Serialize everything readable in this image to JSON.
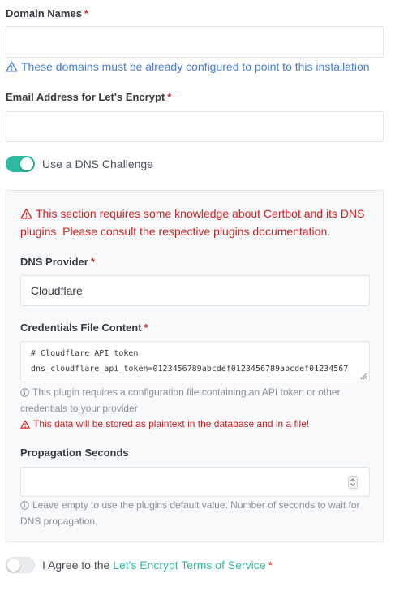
{
  "domain_names": {
    "label": "Domain Names",
    "required_mark": "*",
    "value": "",
    "hint": "These domains must be already configured to point to this installation"
  },
  "email": {
    "label": "Email Address for Let's Encrypt",
    "required_mark": "*",
    "value": ""
  },
  "dns_challenge": {
    "toggle_on": true,
    "label": "Use a DNS Challenge"
  },
  "dns_section": {
    "warning_line1": "This section requires some knowledge about Certbot and its DNS",
    "warning_line2": "plugins. Please consult the respective plugins documentation.",
    "provider_label": "DNS Provider",
    "provider_value": "Cloudflare",
    "credentials_label": "Credentials File Content",
    "credentials_line1": "# Cloudflare API token",
    "credentials_line2": "dns_cloudflare_api_token=0123456789abcdef0123456789abcdef01234567",
    "credentials_info_line1": "This plugin requires a configuration file containing an API token or other",
    "credentials_info_line2": "credentials to your provider",
    "credentials_warning": "This data will be stored as plaintext in the database and in a file!",
    "propagation_label": "Propagation Seconds",
    "propagation_value": "",
    "propagation_info_line1": "Leave empty to use the plugins default value. Number of seconds to wait for",
    "propagation_info_line2": "DNS propagation."
  },
  "agree": {
    "toggle_on": false,
    "prefix": "I Agree to the",
    "link_text": "Let's Encrypt Terms of Service",
    "required_mark": "*"
  },
  "colors": {
    "accent": "#2fb99f",
    "required": "#cd201f",
    "hint_blue": "#467fcf"
  }
}
